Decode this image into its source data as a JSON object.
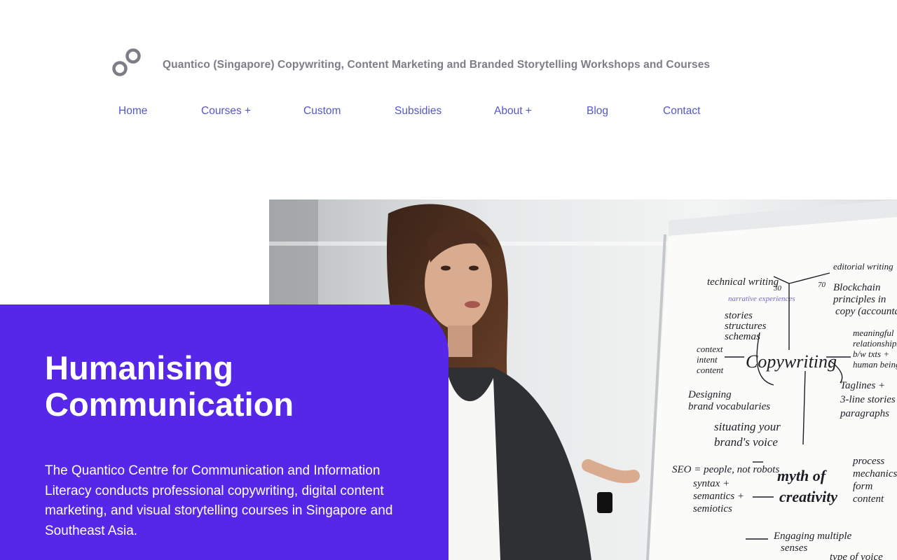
{
  "site_title": "Quantico (Singapore) Copywriting, Content Marketing and Branded Storytelling Workshops and Courses",
  "logo_icon": "linked-rings-icon",
  "nav": {
    "items": [
      {
        "label": "Home"
      },
      {
        "label": "Courses +"
      },
      {
        "label": "Custom"
      },
      {
        "label": "Subsidies"
      },
      {
        "label": "About +"
      },
      {
        "label": "Blog"
      },
      {
        "label": "Contact"
      }
    ]
  },
  "hero": {
    "heading_line1": "Humanising",
    "heading_line2": "Communication",
    "body": "The Quantico Centre for Communication and Information Literacy conducts professional copywriting, digital content marketing, and visual storytelling courses in Singapore and Southeast Asia.",
    "image_icon": "presenter-at-flipchart-photo",
    "flipchart": {
      "left_col": [
        "technical writing",
        "narrative experiences",
        "stories",
        "structures",
        "schemas",
        "context",
        "intent",
        "content",
        "Designing",
        "brand vocabularies",
        "situating your",
        "brand's voice",
        "SEO = people, not robots",
        "syntax +",
        "semantics +",
        "semiotics",
        "Engaging multiple",
        "senses"
      ],
      "center": "Copywriting",
      "numbers": [
        "30",
        "70"
      ],
      "right_col": [
        "editorial writing",
        "Blockchain",
        "principles in",
        "copy (accountability)",
        "meaningful",
        "relationships",
        "b/w txts +",
        "human beings",
        "Taglines +",
        "3-line stories",
        "paragraphs",
        "process",
        "mechanics",
        "form",
        "content",
        "type of voice"
      ],
      "myth": [
        "myth of",
        "creativity"
      ]
    }
  },
  "colors": {
    "accent_purple": "#5627e8",
    "nav_link": "#5656c8",
    "title_gray": "#7d7d88"
  }
}
